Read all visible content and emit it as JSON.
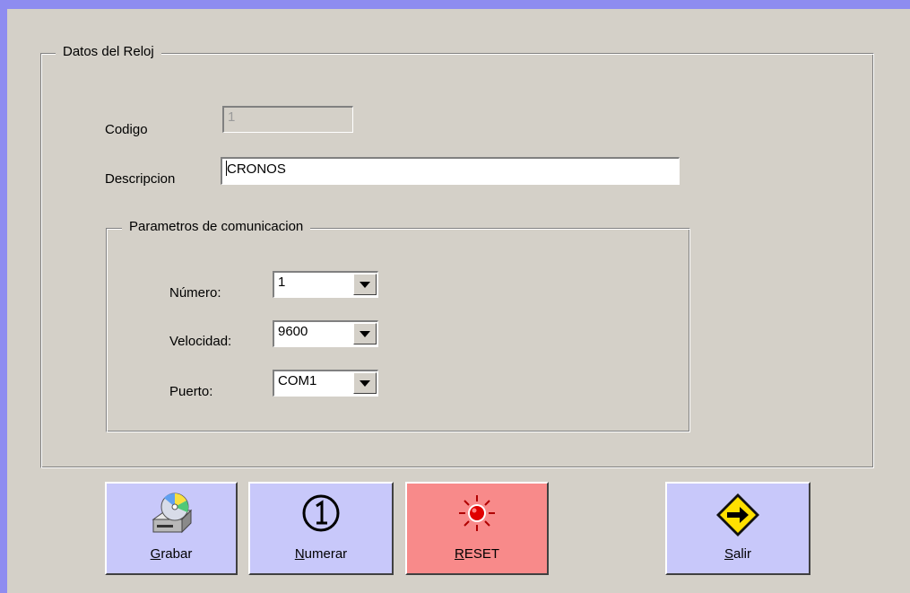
{
  "group_datos": {
    "title": "Datos del Reloj"
  },
  "codigo": {
    "label": "Codigo",
    "value": "1"
  },
  "descripcion": {
    "label": "Descripcion",
    "value": "CRONOS"
  },
  "group_params": {
    "title": "Parametros de comunicacion"
  },
  "numero": {
    "label": "Número:",
    "value": "1"
  },
  "velocidad": {
    "label": "Velocidad:",
    "value": "9600"
  },
  "puerto": {
    "label": "Puerto:",
    "value": "COM1"
  },
  "buttons": {
    "grabar": {
      "mnemonic": "G",
      "rest": "rabar"
    },
    "numerar": {
      "mnemonic": "N",
      "rest": "umerar"
    },
    "reset": {
      "mnemonic": "R",
      "rest": "ESET"
    },
    "salir": {
      "mnemonic": "S",
      "rest": "alir"
    }
  },
  "colors": {
    "border_accent": "#8e8cf0",
    "button_face": "#c8c8fa",
    "reset_face": "#f88a8a",
    "window_bg": "#d4d0c8"
  },
  "icons": {
    "grabar": "disk-drive-icon",
    "numerar": "circled-one-icon",
    "reset": "red-light-icon",
    "salir": "exit-arrow-sign-icon"
  }
}
